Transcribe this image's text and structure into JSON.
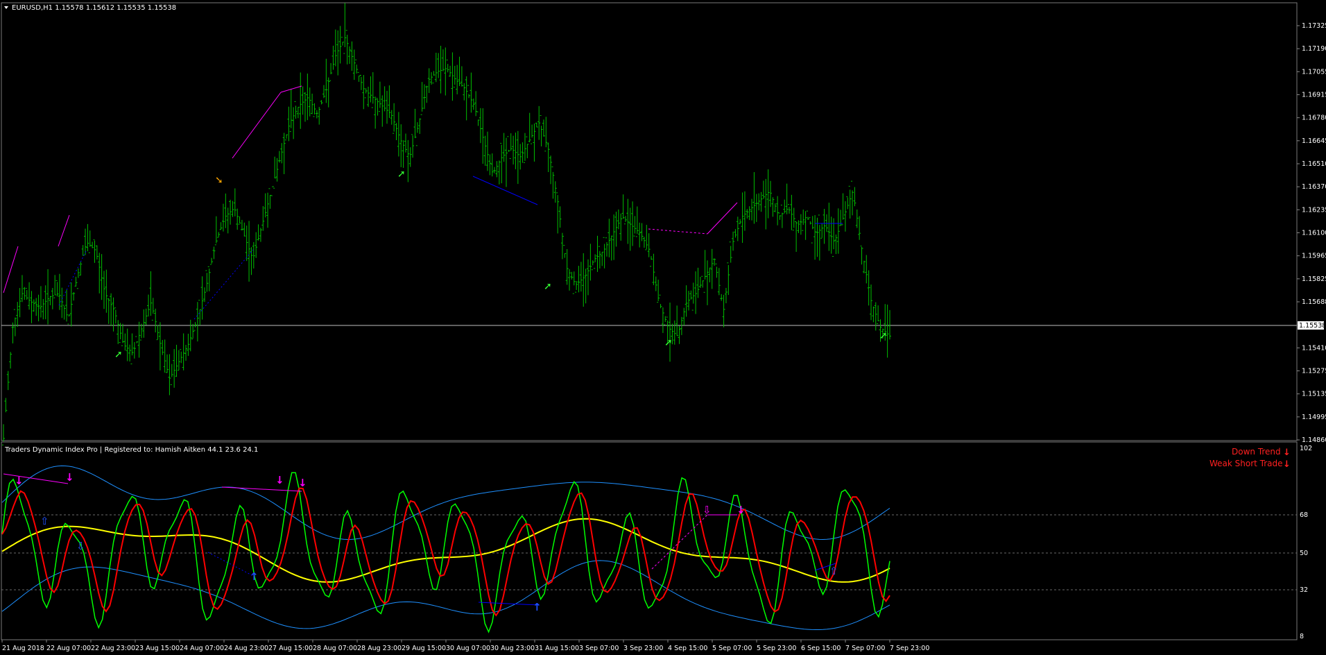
{
  "main": {
    "symbol_line": "EURUSD,H1  1.15578 1.15612 1.15535 1.15538",
    "current_price": "1.15538",
    "price_axis": [
      "1.17325",
      "1.17190",
      "1.17055",
      "1.16915",
      "1.16780",
      "1.16645",
      "1.16510",
      "1.16370",
      "1.16235",
      "1.16100",
      "1.15965",
      "1.15825",
      "1.15688",
      "1.15538",
      "1.15410",
      "1.15275",
      "1.15135",
      "1.14995",
      "1.14860"
    ],
    "price_range": [
      1.1486,
      1.1741
    ]
  },
  "indicator": {
    "title": "Traders Dynamic Index Pro | Registered to: Hamish Aitken 44.1 23.6 24.1",
    "signals": [
      "Down Trend",
      "Weak Short Trade"
    ],
    "levels": [
      "102",
      "68",
      "50",
      "32",
      "8"
    ]
  },
  "time_axis": [
    "21 Aug 2018",
    "22 Aug 07:00",
    "22 Aug 23:00",
    "23 Aug 15:00",
    "24 Aug 07:00",
    "24 Aug 23:00",
    "27 Aug 15:00",
    "28 Aug 07:00",
    "28 Aug 23:00",
    "29 Aug 15:00",
    "30 Aug 07:00",
    "30 Aug 23:00",
    "31 Aug 15:00",
    "3 Sep 07:00",
    "3 Sep 23:00",
    "4 Sep 15:00",
    "5 Sep 07:00",
    "5 Sep 23:00",
    "6 Sep 15:00",
    "7 Sep 07:00",
    "7 Sep 23:00"
  ],
  "colors": {
    "background": "#000000",
    "candles": "#00c000",
    "tdi_green": "#00ff00",
    "tdi_red": "#ff0000",
    "tdi_yellow": "#ffff00",
    "bands": "#1e90ff",
    "divergence": "#ff00ff",
    "signal_text": "#ff0000"
  },
  "chart_data": {
    "type": "line",
    "title": "EURUSD,H1",
    "ylim": [
      1.1486,
      1.1741
    ],
    "close_series": [
      1.1495,
      1.156,
      1.158,
      1.1575,
      1.1572,
      1.1578,
      1.158,
      1.1565,
      1.159,
      1.161,
      1.1605,
      1.158,
      1.157,
      1.155,
      1.1545,
      1.156,
      1.1575,
      1.155,
      1.153,
      1.154,
      1.155,
      1.1565,
      1.1585,
      1.161,
      1.1625,
      1.163,
      1.1615,
      1.16,
      1.162,
      1.164,
      1.166,
      1.168,
      1.169,
      1.1695,
      1.1685,
      1.17,
      1.172,
      1.173,
      1.1715,
      1.17,
      1.1695,
      1.169,
      1.1685,
      1.167,
      1.166,
      1.168,
      1.1705,
      1.171,
      1.1712,
      1.1705,
      1.17,
      1.169,
      1.167,
      1.165,
      1.166,
      1.1665,
      1.166,
      1.167,
      1.168,
      1.1665,
      1.1635,
      1.1595,
      1.1585,
      1.159,
      1.16,
      1.1605,
      1.1615,
      1.1625,
      1.162,
      1.1615,
      1.1605,
      1.1575,
      1.156,
      1.1555,
      1.1575,
      1.158,
      1.159,
      1.16,
      1.157,
      1.161,
      1.1625,
      1.163,
      1.1635,
      1.164,
      1.1625,
      1.163,
      1.162,
      1.1625,
      1.1615,
      1.162,
      1.161,
      1.1625,
      1.164,
      1.1605,
      1.1575,
      1.156,
      1.1555
    ]
  }
}
